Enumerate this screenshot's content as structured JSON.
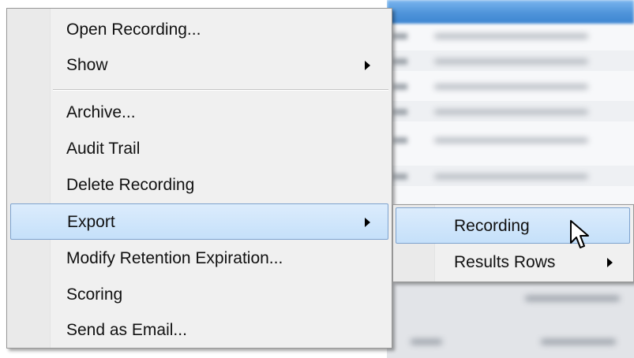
{
  "context_menu": {
    "items": [
      {
        "label": "Open Recording...",
        "has_submenu": false
      },
      {
        "label": "Show",
        "has_submenu": true
      },
      {
        "label": "Archive...",
        "has_submenu": false
      },
      {
        "label": "Audit Trail",
        "has_submenu": false
      },
      {
        "label": "Delete Recording",
        "has_submenu": false
      },
      {
        "label": "Export",
        "has_submenu": true,
        "highlighted": true
      },
      {
        "label": "Modify Retention Expiration...",
        "has_submenu": false
      },
      {
        "label": "Scoring",
        "has_submenu": false
      },
      {
        "label": "Send as Email...",
        "has_submenu": false
      }
    ]
  },
  "export_submenu": {
    "items": [
      {
        "label": "Recording",
        "highlighted": true,
        "has_submenu": false
      },
      {
        "label": "Results Rows",
        "has_submenu": true
      }
    ]
  },
  "icons": {
    "submenu_arrow": "chevron-right-icon",
    "cursor": "mouse-pointer-icon"
  },
  "colors": {
    "highlight_fill": "#c5e0fa",
    "highlight_border": "#7da2ce",
    "menu_background": "#f0f0f0",
    "header_blue": "#4f94da"
  }
}
